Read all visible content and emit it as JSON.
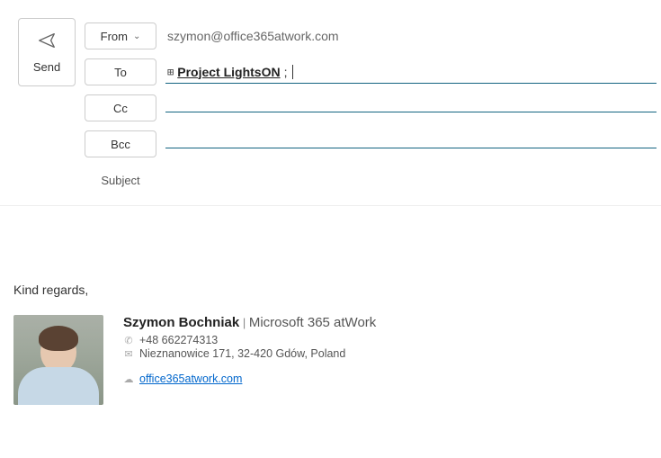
{
  "send": {
    "label": "Send"
  },
  "fields": {
    "from": {
      "btn": "From",
      "value": "szymon@office365atwork.com"
    },
    "to": {
      "btn": "To",
      "value": "Project LightsON"
    },
    "cc": {
      "btn": "Cc",
      "value": ""
    },
    "bcc": {
      "btn": "Bcc",
      "value": ""
    },
    "subject": {
      "label": "Subject",
      "value": ""
    }
  },
  "body": {
    "signoff": "Kind regards,"
  },
  "signature": {
    "name": "Szymon Bochniak",
    "separator": "|",
    "company": "Microsoft 365 atWork",
    "phone": "+48 662274313",
    "address": "Nieznanowice 171, 32-420 Gdów, Poland",
    "website": "office365atwork.com"
  }
}
